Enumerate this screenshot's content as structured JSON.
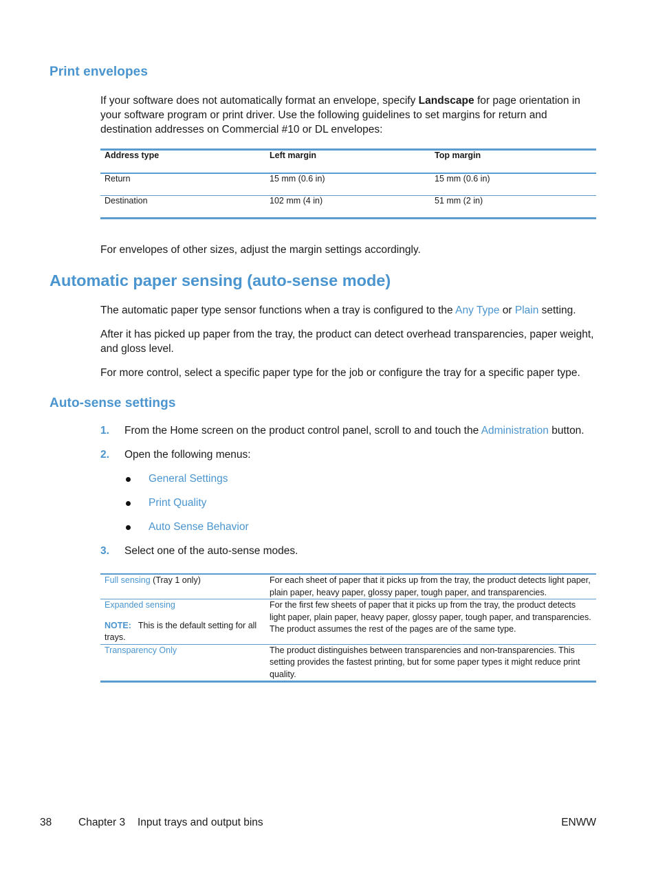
{
  "sections": {
    "print_envelopes": {
      "heading": "Print envelopes",
      "intro_before_bold": "If your software does not automatically format an envelope, specify ",
      "intro_bold": "Landscape",
      "intro_after_bold": " for page orientation in your software program or print driver. Use the following guidelines to set margins for return and destination addresses on Commercial #10 or DL envelopes:",
      "table": {
        "headers": [
          "Address type",
          "Left margin",
          "Top margin"
        ],
        "rows": [
          [
            "Return",
            "15 mm (0.6 in)",
            "15 mm (0.6 in)"
          ],
          [
            "Destination",
            "102 mm (4 in)",
            "51 mm (2 in)"
          ]
        ]
      },
      "outro": "For envelopes of other sizes, adjust the margin settings accordingly."
    },
    "auto_sensing": {
      "heading": "Automatic paper sensing (auto-sense mode)",
      "p1_before": "The automatic paper type sensor functions when a tray is configured to the ",
      "p1_link1": "Any Type",
      "p1_mid": " or ",
      "p1_link2": "Plain",
      "p1_after": " setting.",
      "p2": "After it has picked up paper from the tray, the product can detect overhead transparencies, paper weight, and gloss level.",
      "p3": "For more control, select a specific paper type for the job or configure the tray for a specific paper type."
    },
    "auto_sense_settings": {
      "heading": "Auto-sense settings",
      "steps": [
        {
          "num": "1.",
          "before": "From the Home screen on the product control panel, scroll to and touch the ",
          "link": "Administration",
          "after": " button."
        },
        {
          "num": "2.",
          "text": "Open the following menus:",
          "menus": [
            "General Settings",
            "Print Quality",
            "Auto Sense Behavior"
          ]
        },
        {
          "num": "3.",
          "text": "Select one of the auto-sense modes."
        }
      ],
      "modes_table": [
        {
          "mode": "Full sensing",
          "mode_suffix": " (Tray 1 only)",
          "description": "For each sheet of paper that it picks up from the tray, the product detects light paper, plain paper, heavy paper, glossy paper, tough paper, and transparencies."
        },
        {
          "mode": "Expanded sensing",
          "note_label": "NOTE:",
          "note_text": "This is the default setting for all trays.",
          "description": "For the first few sheets of paper that it picks up from the tray, the product detects light paper, plain paper, heavy paper, glossy paper, tough paper, and transparencies. The product assumes the rest of the pages are of the same type."
        },
        {
          "mode": "Transparency Only",
          "description": "The product distinguishes between transparencies and non-transparencies. This setting provides the fastest printing, but for some paper types it might reduce print quality."
        }
      ]
    }
  },
  "footer": {
    "page_number": "38",
    "chapter": "Chapter 3",
    "chapter_title": "Input trays and output bins",
    "locale": "ENWW"
  },
  "colors": {
    "accent": "#4a95cf",
    "rule": "#5a9bd0",
    "text": "#1a1a1a"
  }
}
